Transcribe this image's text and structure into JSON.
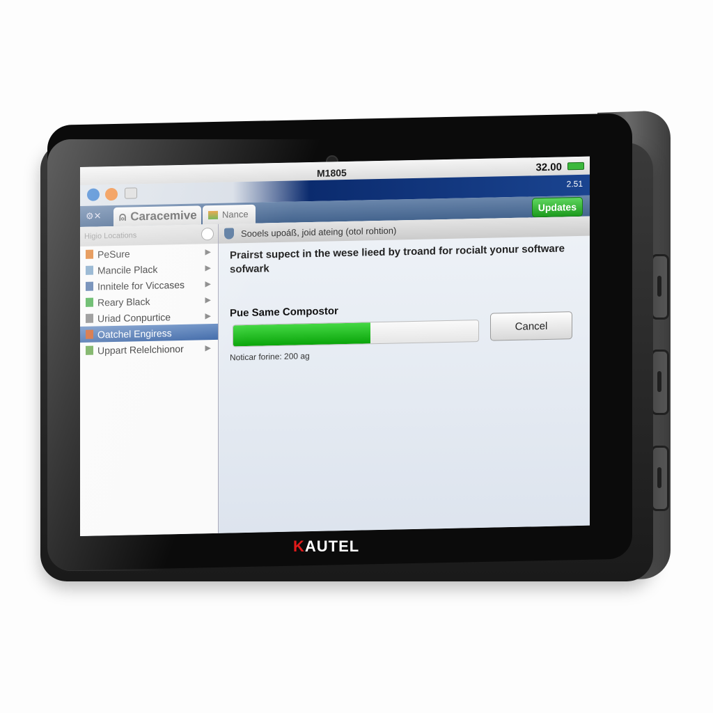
{
  "device": {
    "brand_first": "K",
    "brand_rest": "AUTEL"
  },
  "statusbar": {
    "title": "M1805",
    "battery_text": "32.00",
    "secondary_number": "2.51"
  },
  "tabs": [
    {
      "label": "Caracemive"
    },
    {
      "label": "Nance"
    }
  ],
  "updates_label": "Updates",
  "sidebar": {
    "header": "Higio Locations",
    "items": [
      {
        "label": "PeSure",
        "color": "#e08030"
      },
      {
        "label": "Mancile Plack",
        "color": "#7fa6c8"
      },
      {
        "label": "Innitele for Viccases",
        "color": "#5577aa"
      },
      {
        "label": "Reary Black",
        "color": "#4caf50"
      },
      {
        "label": "Uriad Conpurtice",
        "color": "#888888"
      },
      {
        "label": "Oatchel Engiress",
        "color": "#d0602a",
        "selected": true
      },
      {
        "label": "Uppart Relelchionor",
        "color": "#6aa84f"
      }
    ]
  },
  "main": {
    "header": "Sooels upoáß, joid ateing (otol rohtion)",
    "message": "Prairst supect in the wese lieed by troand for rocialt yonur software sofwark",
    "progress_label": "Pue Same Compostor",
    "progress_percent": 56,
    "progress_note": "Noticar forine: 200 ag",
    "cancel_label": "Cancel"
  },
  "colors": {
    "accent_green": "#1c9a1c",
    "nav_blue": "#0b2b6e",
    "selected_blue": "#3e68a8",
    "brand_red": "#e01a1a"
  }
}
